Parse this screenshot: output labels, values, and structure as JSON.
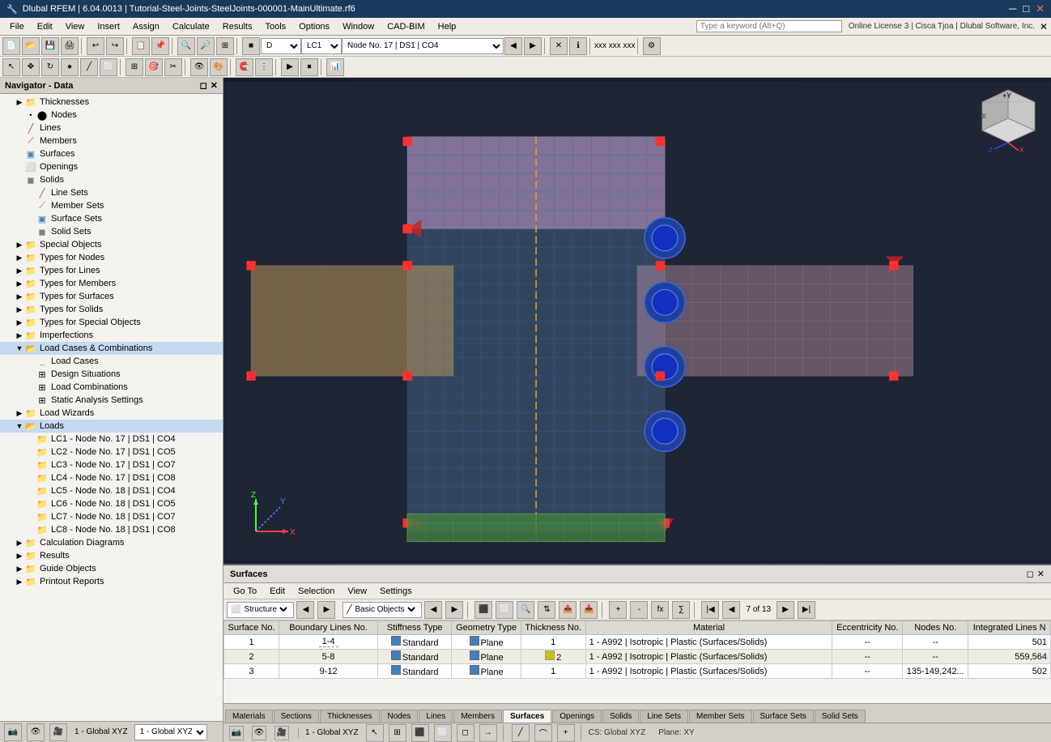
{
  "titleBar": {
    "title": "Dlubal RFEM | 6.04.0013 | Tutorial-Steel-Joints-SteelJoints-000001-MainUltimate.rf6",
    "appIcon": "🔧",
    "minBtn": "─",
    "maxBtn": "□",
    "closeBtn": "✕",
    "subCloseBtn": "✕",
    "subMaxBtn": "□"
  },
  "menuBar": {
    "items": [
      "File",
      "Edit",
      "View",
      "Insert",
      "Assign",
      "Calculate",
      "Results",
      "Tools",
      "Options",
      "Window",
      "CAD-BIM",
      "Help"
    ],
    "searchPlaceholder": "Type a keyword (Alt+Q)",
    "licenseInfo": "Online License 3 | Cisca Tjoa | Dlubal Software, Inc."
  },
  "toolbar2": {
    "combo1": "LC1",
    "combo2": "Node No. 17 | DS1 | CO4"
  },
  "navigator": {
    "title": "Navigator - Data",
    "items": [
      {
        "indent": 1,
        "label": "Thicknesses",
        "hasArrow": true,
        "expanded": false
      },
      {
        "indent": 2,
        "label": "Nodes",
        "hasArrow": false,
        "expanded": false
      },
      {
        "indent": 1,
        "label": "Lines",
        "hasArrow": false,
        "expanded": false
      },
      {
        "indent": 1,
        "label": "Members",
        "hasArrow": false,
        "expanded": false
      },
      {
        "indent": 1,
        "label": "Surfaces",
        "hasArrow": false,
        "expanded": false
      },
      {
        "indent": 1,
        "label": "Openings",
        "hasArrow": false,
        "expanded": false
      },
      {
        "indent": 1,
        "label": "Solids",
        "hasArrow": false,
        "expanded": false
      },
      {
        "indent": 2,
        "label": "Line Sets",
        "hasArrow": false,
        "expanded": false
      },
      {
        "indent": 2,
        "label": "Member Sets",
        "hasArrow": false,
        "expanded": false
      },
      {
        "indent": 2,
        "label": "Surface Sets",
        "hasArrow": false,
        "expanded": false
      },
      {
        "indent": 2,
        "label": "Solid Sets",
        "hasArrow": false,
        "expanded": false
      },
      {
        "indent": 1,
        "label": "Special Objects",
        "hasArrow": true,
        "expanded": false
      },
      {
        "indent": 1,
        "label": "Types for Nodes",
        "hasArrow": true,
        "expanded": false
      },
      {
        "indent": 1,
        "label": "Types for Lines",
        "hasArrow": true,
        "expanded": false
      },
      {
        "indent": 1,
        "label": "Types for Members",
        "hasArrow": true,
        "expanded": false
      },
      {
        "indent": 1,
        "label": "Types for Surfaces",
        "hasArrow": true,
        "expanded": false
      },
      {
        "indent": 1,
        "label": "Types for Solids",
        "hasArrow": true,
        "expanded": false
      },
      {
        "indent": 1,
        "label": "Types for Special Objects",
        "hasArrow": true,
        "expanded": false
      },
      {
        "indent": 1,
        "label": "Imperfections",
        "hasArrow": true,
        "expanded": false
      },
      {
        "indent": 1,
        "label": "Load Cases & Combinations",
        "hasArrow": true,
        "expanded": true
      },
      {
        "indent": 2,
        "label": "Load Cases",
        "hasArrow": false,
        "expanded": false
      },
      {
        "indent": 2,
        "label": "Design Situations",
        "hasArrow": false,
        "expanded": false
      },
      {
        "indent": 2,
        "label": "Load Combinations",
        "hasArrow": false,
        "expanded": false
      },
      {
        "indent": 2,
        "label": "Static Analysis Settings",
        "hasArrow": false,
        "expanded": false
      },
      {
        "indent": 1,
        "label": "Load Wizards",
        "hasArrow": true,
        "expanded": false
      },
      {
        "indent": 1,
        "label": "Loads",
        "hasArrow": true,
        "expanded": true
      },
      {
        "indent": 2,
        "label": "LC1 - Node No. 17 | DS1 | CO4",
        "hasArrow": false
      },
      {
        "indent": 2,
        "label": "LC2 - Node No. 17 | DS1 | CO5",
        "hasArrow": false
      },
      {
        "indent": 2,
        "label": "LC3 - Node No. 17 | DS1 | CO7",
        "hasArrow": false
      },
      {
        "indent": 2,
        "label": "LC4 - Node No. 17 | DS1 | CO8",
        "hasArrow": false
      },
      {
        "indent": 2,
        "label": "LC5 - Node No. 18 | DS1 | CO4",
        "hasArrow": false
      },
      {
        "indent": 2,
        "label": "LC6 - Node No. 18 | DS1 | CO5",
        "hasArrow": false
      },
      {
        "indent": 2,
        "label": "LC7 - Node No. 18 | DS1 | CO7",
        "hasArrow": false
      },
      {
        "indent": 2,
        "label": "LC8 - Node No. 18 | DS1 | CO8",
        "hasArrow": false
      },
      {
        "indent": 1,
        "label": "Calculation Diagrams",
        "hasArrow": true,
        "expanded": false
      },
      {
        "indent": 1,
        "label": "Results",
        "hasArrow": true,
        "expanded": false
      },
      {
        "indent": 1,
        "label": "Guide Objects",
        "hasArrow": true,
        "expanded": false
      },
      {
        "indent": 1,
        "label": "Printout Reports",
        "hasArrow": true,
        "expanded": false
      }
    ]
  },
  "surfacesPanel": {
    "title": "Surfaces",
    "menus": [
      "Go To",
      "Edit",
      "Selection",
      "View",
      "Settings"
    ],
    "filterCombo": "Structure",
    "filterCombo2": "Basic Objects",
    "columns": [
      "Surface No.",
      "Boundary Lines No.",
      "Stiffness Type",
      "Geometry Type",
      "Thickness No.",
      "Material",
      "Eccentricity No.",
      "Nodes No.",
      "Integrated Lines N"
    ],
    "rows": [
      {
        "no": 1,
        "lines": "1-4",
        "stiffType": "Standard",
        "geoType": "Plane",
        "thickNo": 1,
        "material": "1 - A992 | Isotropic | Plastic (Surfaces/Solids)",
        "ecc": "--",
        "nodes": "--",
        "intLines": "501"
      },
      {
        "no": 2,
        "lines": "5-8",
        "stiffType": "Standard",
        "geoType": "Plane",
        "thickNo": 2,
        "material": "1 - A992 | Isotropic | Plastic (Surfaces/Solids)",
        "ecc": "--",
        "nodes": "--",
        "intLines": "559,564"
      },
      {
        "no": 3,
        "lines": "9-12",
        "stiffType": "Standard",
        "geoType": "Plane",
        "thickNo": 1,
        "material": "1 - A992 | Isotropic | Plastic (Surfaces/Solids)",
        "ecc": "--",
        "nodes": "135-149,242...",
        "intLines": "502"
      }
    ],
    "pagination": "7 of 13"
  },
  "bottomTabs": [
    "Materials",
    "Sections",
    "Thicknesses",
    "Nodes",
    "Lines",
    "Members",
    "Surfaces",
    "Openings",
    "Solids",
    "Line Sets",
    "Member Sets",
    "Surface Sets",
    "Solid Sets"
  ],
  "activeTab": "Surfaces",
  "statusBar": {
    "csInfo": "CS: Global XYZ",
    "planeInfo": "Plane: XY",
    "viewIcon1": "👁",
    "viewIcon2": "▶"
  },
  "navBottomIcons": [
    "📷",
    "👁",
    "🎥"
  ],
  "cube": {
    "label": "+Y"
  },
  "axes": {
    "x": "X",
    "y": "Y",
    "z": "Z"
  }
}
